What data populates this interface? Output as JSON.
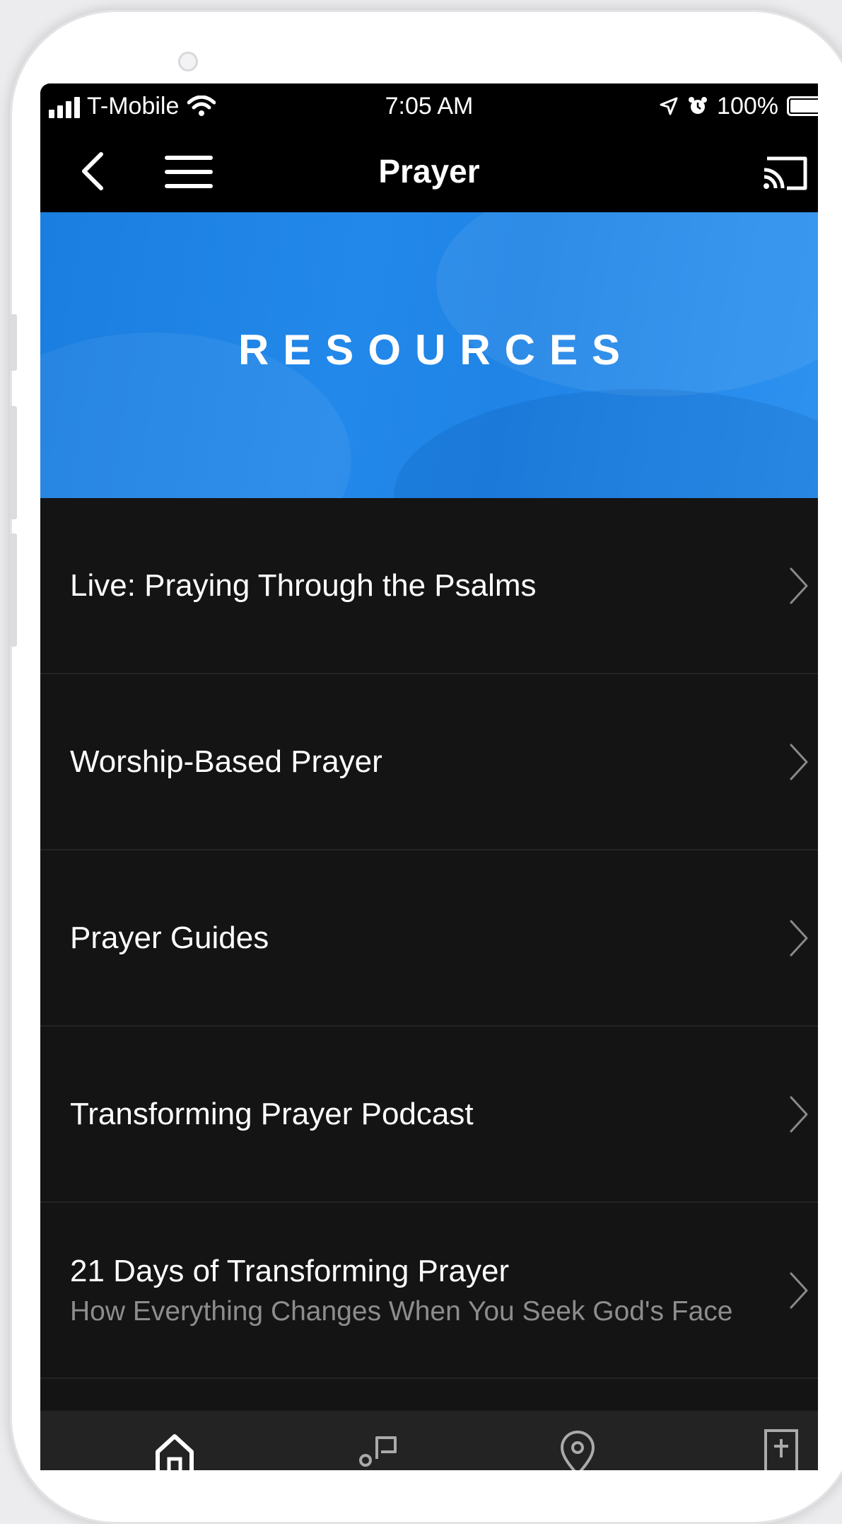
{
  "status_bar": {
    "carrier": "T-Mobile",
    "time": "7:05 AM",
    "battery": "100%"
  },
  "nav": {
    "title": "Prayer"
  },
  "banner": {
    "title": "RESOURCES",
    "color": "#1f84e6"
  },
  "items": [
    {
      "title": "Live: Praying Through the Psalms",
      "subtitle": ""
    },
    {
      "title": "Worship-Based Prayer",
      "subtitle": ""
    },
    {
      "title": "Prayer Guides",
      "subtitle": ""
    },
    {
      "title": "Transforming Prayer Podcast",
      "subtitle": ""
    },
    {
      "title": "21 Days of Transforming Prayer",
      "subtitle": "How Everything Changes When You Seek God's Face"
    }
  ],
  "tab_bar": {
    "tabs": [
      {
        "icon": "home-icon"
      },
      {
        "icon": "message-icon"
      },
      {
        "icon": "location-pin-icon"
      },
      {
        "icon": "bible-icon"
      }
    ]
  }
}
